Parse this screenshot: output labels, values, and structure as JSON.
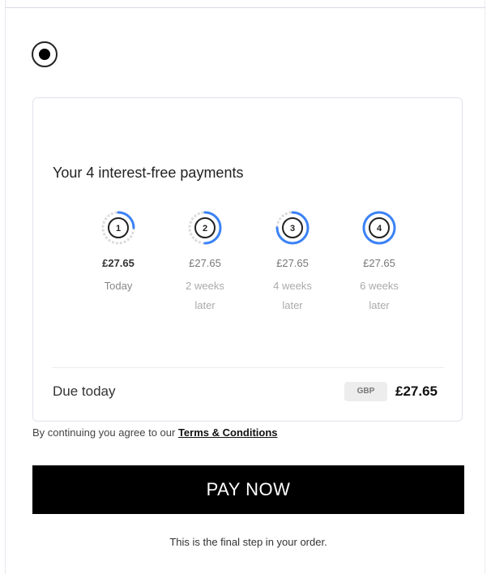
{
  "payment_option": {
    "selected": true
  },
  "plan": {
    "title": "Your 4 interest-free payments",
    "installments": [
      {
        "number": "1",
        "amount": "£27.65",
        "when": "Today",
        "progress": 0.25
      },
      {
        "number": "2",
        "amount": "£27.65",
        "when": "2 weeks later",
        "progress": 0.5
      },
      {
        "number": "3",
        "amount": "£27.65",
        "when": "4 weeks later",
        "progress": 0.75
      },
      {
        "number": "4",
        "amount": "£27.65",
        "when": "6 weeks later",
        "progress": 1.0
      }
    ],
    "due_label": "Due today",
    "currency": "GBP",
    "due_amount": "£27.65"
  },
  "terms": {
    "prefix": "By continuing you agree to our ",
    "link": "Terms & Conditions"
  },
  "pay_button": {
    "label": "PAY NOW"
  },
  "footer": {
    "note": "This is the final step in your order."
  },
  "colors": {
    "accent": "#3b82f6",
    "button_bg": "#000000",
    "ring_bg": "#dcdcdc"
  }
}
